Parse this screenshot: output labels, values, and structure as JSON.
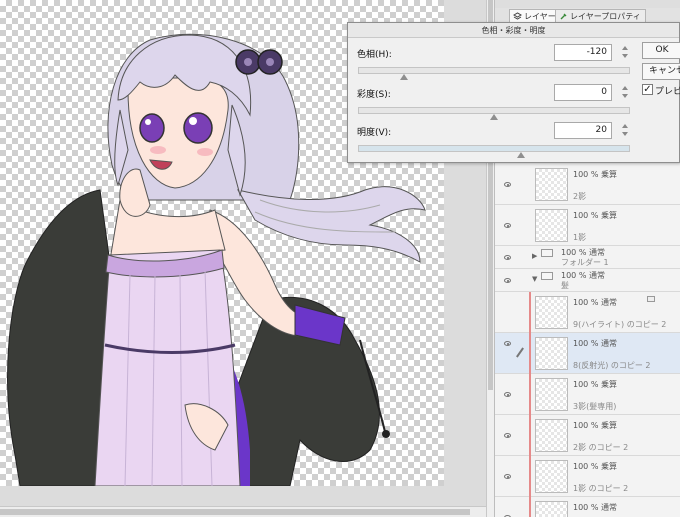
{
  "panel": {
    "tabs": [
      {
        "label": "レイヤー",
        "icon": "layers-icon"
      },
      {
        "label": "レイヤープロパティ",
        "icon": "wrench-icon"
      }
    ],
    "layers": [
      {
        "mode": "100 % 乗算",
        "name": "2影"
      },
      {
        "mode": "100 % 乗算",
        "name": "1影"
      },
      {
        "mode": "100 % 通常",
        "name": "フォルダー 1"
      },
      {
        "mode": "100 % 通常",
        "name": "髪"
      },
      {
        "mode": "100 % 通常",
        "name": "9(ハイライト) のコピー 2"
      },
      {
        "mode": "100 % 通常",
        "name": "8(反射光) のコピー 2"
      },
      {
        "mode": "100 % 乗算",
        "name": "3影(髪専用)"
      },
      {
        "mode": "100 % 乗算",
        "name": "2影 のコピー 2"
      },
      {
        "mode": "100 % 乗算",
        "name": "1影 のコピー 2"
      },
      {
        "mode": "100 % 通常",
        "name": ""
      }
    ]
  },
  "dialog": {
    "title": "色相・彩度・明度",
    "hue": {
      "label": "色相(H):",
      "value": "-120",
      "fraction": 0.17
    },
    "saturation": {
      "label": "彩度(S):",
      "value": "0",
      "fraction": 0.5
    },
    "brightness": {
      "label": "明度(V):",
      "value": "20",
      "fraction": 0.6
    },
    "ok_label": "OK",
    "cancel_label": "キャンセル",
    "preview_label": "プレビュー",
    "preview_checked": "✓"
  },
  "colors": {
    "hair": "#d8d2e8",
    "eyes": "#7a3fb5",
    "jacket": "#3a3c38",
    "dress": "#ead6f2",
    "bow": "#4a3a66",
    "inner": "#6b36c9",
    "skin": "#fde6dc"
  }
}
